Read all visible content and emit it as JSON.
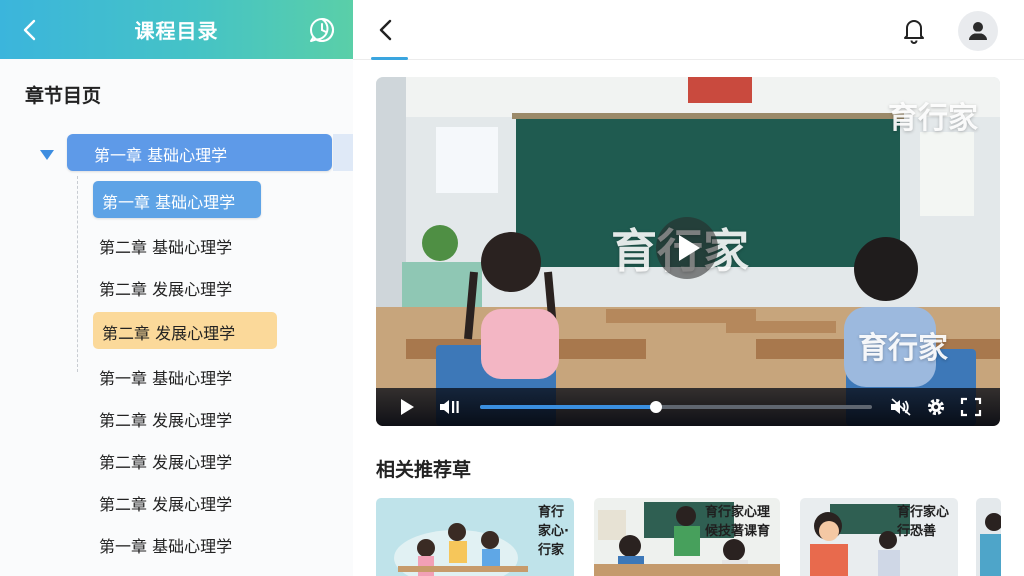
{
  "sidebar": {
    "title": "课程目录",
    "subtitle": "章节目页",
    "root_chapter": "第一章 基础心理学",
    "items": [
      {
        "label": "第一章 基础心理学",
        "state": "selected"
      },
      {
        "label": "第二章 基础心理学",
        "state": "normal"
      },
      {
        "label": "第二章 发展心理学",
        "state": "normal"
      },
      {
        "label": "第二章 发展心理学",
        "state": "highlighted"
      },
      {
        "label": "第一章 基础心理学",
        "state": "normal"
      },
      {
        "label": "第二章 发展心理学",
        "state": "normal"
      },
      {
        "label": "第二章 发展心理学",
        "state": "normal"
      },
      {
        "label": "第二章 发展心理学",
        "state": "normal"
      },
      {
        "label": "第一章 基础心理学",
        "state": "normal"
      }
    ]
  },
  "video": {
    "watermarks": [
      "育行家",
      "育行家",
      "育行家"
    ],
    "progress": 0.45,
    "accent": "#3a8fe0"
  },
  "related": {
    "title": "相关推荐草",
    "cards": [
      {
        "text": [
          "育行",
          "家心·",
          "行家"
        ]
      },
      {
        "text": [
          "育行家心理",
          "候技著课育"
        ]
      },
      {
        "text": [
          "育行家心",
          "行恐善"
        ]
      },
      {
        "text": []
      }
    ]
  },
  "icons": {
    "back": "chevron-left-icon",
    "chat": "chat-clock-icon",
    "bell": "bell-icon",
    "avatar": "user-avatar-icon",
    "play": "play-icon",
    "volume": "volume-icon",
    "mute": "volume-mute-icon",
    "settings": "gear-icon",
    "fullscreen": "fullscreen-icon"
  },
  "colors": {
    "header_gradient_start": "#3bb5dc",
    "header_gradient_end": "#5acfa8",
    "selected_blue": "#5ea3e6",
    "highlight_amber": "#fbd99a"
  }
}
